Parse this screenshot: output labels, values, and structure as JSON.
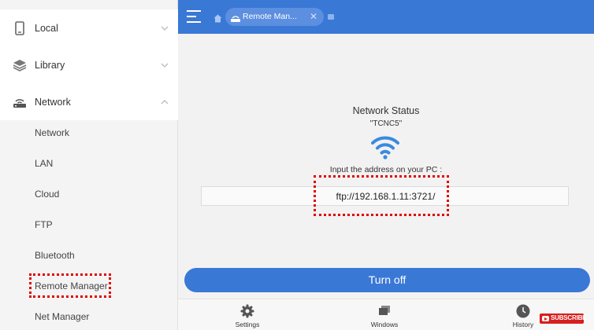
{
  "sidebar": {
    "groups": [
      {
        "label": "Local",
        "icon": "phone-icon",
        "expanded": false
      },
      {
        "label": "Library",
        "icon": "stack-icon",
        "expanded": false
      },
      {
        "label": "Network",
        "icon": "router-icon",
        "expanded": true
      }
    ],
    "network_items": [
      {
        "label": "Network"
      },
      {
        "label": "LAN"
      },
      {
        "label": "Cloud"
      },
      {
        "label": "FTP"
      },
      {
        "label": "Bluetooth"
      },
      {
        "label": "Remote Manager"
      },
      {
        "label": "Net Manager"
      }
    ]
  },
  "header": {
    "tab_label": "Remote Man...",
    "accent": "#3a78d6"
  },
  "main": {
    "status_title": "Network Status",
    "ssid": "\"TCNC5\"",
    "prompt": "Input the address on your PC :",
    "address": "ftp://192.168.1.11:3721/",
    "turn_off_label": "Turn off"
  },
  "bottom_nav": [
    {
      "label": "Settings",
      "icon": "gear-icon"
    },
    {
      "label": "Windows",
      "icon": "windows-stack-icon"
    },
    {
      "label": "History",
      "icon": "clock-icon"
    }
  ],
  "overlay": {
    "subscribe_label": "SUBSCRIBE",
    "highlight_color": "#e00000"
  }
}
